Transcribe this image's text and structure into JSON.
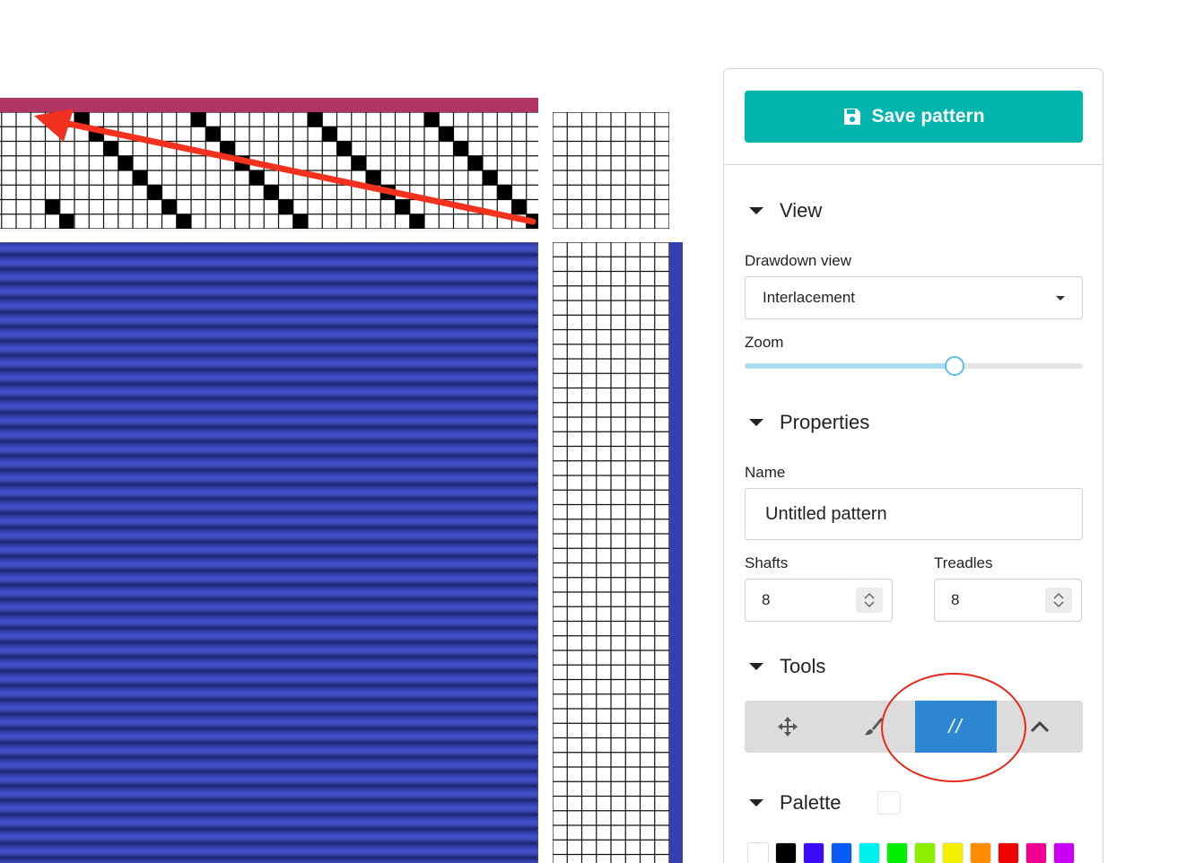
{
  "editor": {
    "warp_color": "#b03564",
    "weft_color": "#3341b0",
    "drawdown_color": "#3a47b5",
    "threading_marks_color": "#000000"
  },
  "annotation": {
    "arrow_color": "#f2321e",
    "highlight_color": "#e8281c"
  },
  "panel": {
    "save_label": "Save pattern",
    "save_icon": "floppy-disk-icon",
    "accent_color": "#00b5ad",
    "view": {
      "title": "View",
      "drawdown_label": "Drawdown view",
      "drawdown_value": "Interlacement",
      "zoom_label": "Zoom",
      "zoom_fraction": 0.62
    },
    "properties": {
      "title": "Properties",
      "name_label": "Name",
      "name_value": "Untitled pattern",
      "shafts_label": "Shafts",
      "shafts_value": "8",
      "treadles_label": "Treadles",
      "treadles_value": "8"
    },
    "tools": {
      "title": "Tools",
      "items": [
        "move-icon",
        "paintbrush-icon",
        "straight-draw-tool",
        "chevron-up-icon"
      ],
      "active_label": "//",
      "active_color": "#2d87d3"
    },
    "palette": {
      "title": "Palette",
      "colors": [
        "#ffffff",
        "#000000",
        "#3a0af5",
        "#0a5af5",
        "#00f0f0",
        "#00f000",
        "#8cf000",
        "#f5f000",
        "#ff8c00",
        "#f00000",
        "#f00090",
        "#c800f5"
      ]
    }
  }
}
